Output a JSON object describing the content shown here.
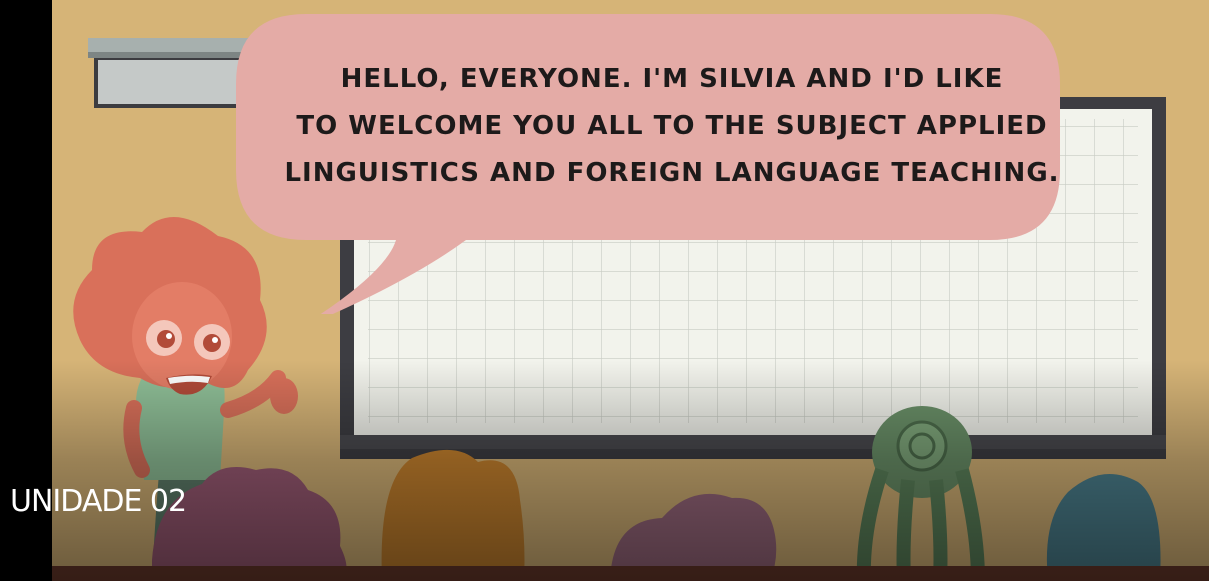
{
  "speech": {
    "line1": "HELLO, EVERYONE. I'M SILVIA AND I'D LIKE",
    "line2": "TO WELCOME YOU ALL TO THE SUBJECT APPLIED",
    "line3": "LINGUISTICS AND FOREIGN LANGUAGE TEACHING."
  },
  "caption": "UNIDADE 02",
  "colors": {
    "wall": "#d6b477",
    "bubble": "#e4aba6",
    "board": "#f2f3ec",
    "board_frame": "#3d3d42",
    "teacher_hair": "#d9705a"
  }
}
